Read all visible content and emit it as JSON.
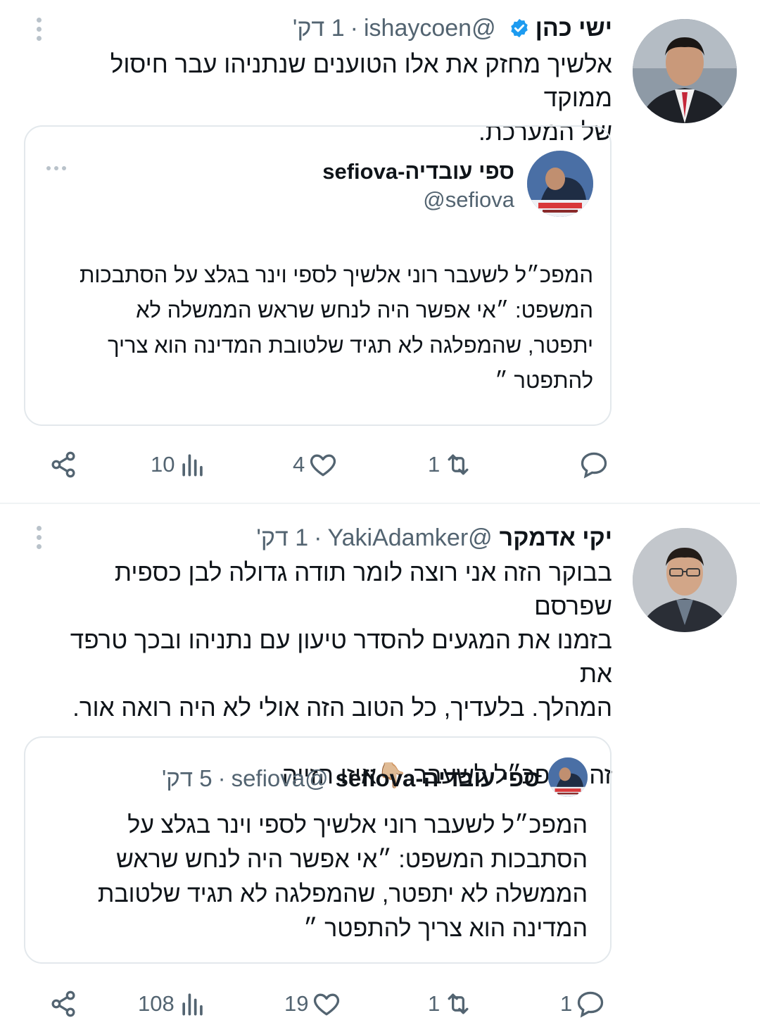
{
  "tweets": [
    {
      "author": {
        "name": "ישי כהן",
        "handle": "@ishaycoen",
        "verified": true,
        "avatar_icon": "profile-photo-man-suit-red-tie"
      },
      "separator": "·",
      "time": "1 דק'",
      "text_lines": [
        "אלשיך מחזק את אלו הטוענים שנתניהו עבר חיסול ממוקד",
        "של המערכת."
      ],
      "quote": {
        "name": "ספי עובדיה-sefiova",
        "handle": "@sefiova",
        "avatar_icon": "profile-photo-news-anchor",
        "text_lines": [
          "המפכ״ל לשעבר רוני אלשיך לספי וינר בגלצ על הסתבכות",
          "המשפט: ״אי אפשר היה לנחש שראש הממשלה לא",
          "יתפטר, שהמפלגה לא תגיד שלטובת המדינה הוא צריך",
          "להתפטר ״"
        ]
      },
      "actions": {
        "reply": "",
        "retweet": "1",
        "like": "4",
        "views": "10"
      }
    },
    {
      "author": {
        "name": "יקי אדמקר",
        "handle": "@YakiAdamker",
        "verified": false,
        "avatar_icon": "profile-photo-man-glasses"
      },
      "separator": "·",
      "time": "1 דק'",
      "text_lines": [
        "בבוקר הזה אני רוצה לומר תודה גדולה לבן כספית שפרסם",
        "בזמנו את המגעים להסדר טיעון עם נתניהו ובכך טרפד את",
        "המהלך. בלעדיך, כל הטוב הזה אולי לא היה רואה אור.",
        "",
        "זה המפכ״ל לשעבר 👇🏼איזו הזייה"
      ],
      "quote": {
        "name": "ספי עובדיה-sefiova",
        "handle": "@sefiova",
        "separator": "·",
        "time": "5 דק'",
        "avatar_icon": "profile-photo-news-anchor",
        "text_lines": [
          "המפכ״ל לשעבר רוני אלשיך לספי וינר בגלצ על",
          "הסתבכות המשפט: ״אי אפשר היה לנחש שראש",
          "הממשלה לא יתפטר, שהמפלגה לא תגיד שלטובת",
          "המדינה הוא צריך להתפטר ״"
        ]
      },
      "actions": {
        "reply": "1",
        "retweet": "1",
        "like": "19",
        "views": "108"
      }
    }
  ],
  "colors": {
    "text_primary": "#0f1419",
    "text_secondary": "#536471",
    "verified_blue": "#1d9bf0",
    "border": "#e3e8ec",
    "background": "#ffffff"
  }
}
